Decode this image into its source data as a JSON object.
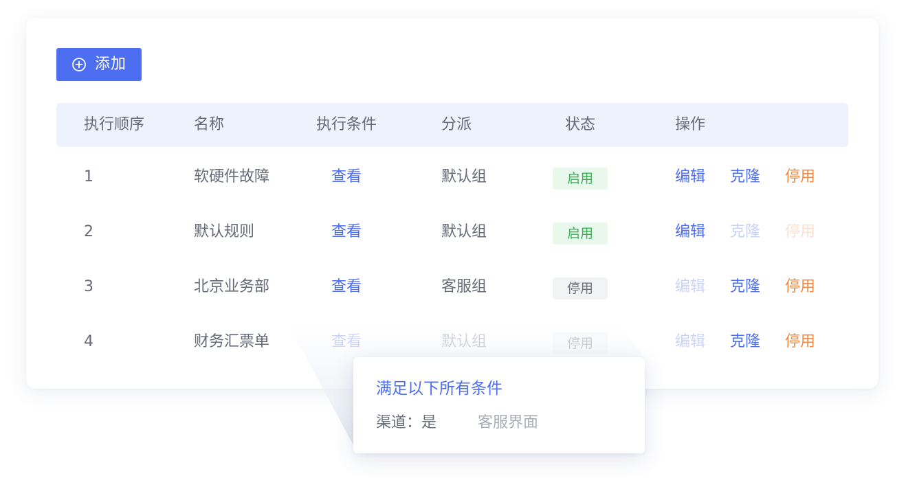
{
  "toolbar": {
    "add_label": "添加",
    "add_icon": "plus-circle-icon"
  },
  "table": {
    "headers": [
      "执行顺序",
      "名称",
      "执行条件",
      "分派",
      "状态",
      "操作"
    ],
    "rows": [
      {
        "order": "1",
        "name": "软硬件故障",
        "condition": "查看",
        "assign": "默认组",
        "status": "启用",
        "status_state": "enabled",
        "actions": {
          "edit": "编辑",
          "clone": "克隆",
          "disable": "停用"
        },
        "action_states": {
          "edit": "active",
          "clone": "active",
          "disable": "active"
        }
      },
      {
        "order": "2",
        "name": "默认规则",
        "condition": "查看",
        "assign": "默认组",
        "status": "启用",
        "status_state": "enabled",
        "actions": {
          "edit": "编辑",
          "clone": "克隆",
          "disable": "停用"
        },
        "action_states": {
          "edit": "active",
          "clone": "disabled",
          "disable": "disabled"
        }
      },
      {
        "order": "3",
        "name": "北京业务部",
        "condition": "查看",
        "assign": "客服组",
        "status": "停用",
        "status_state": "disabled",
        "actions": {
          "edit": "编辑",
          "clone": "克隆",
          "disable": "停用"
        },
        "action_states": {
          "edit": "disabled",
          "clone": "active",
          "disable": "active"
        }
      },
      {
        "order": "4",
        "name": "财务汇票单",
        "condition": "查看",
        "assign": "默认组",
        "status": "停用",
        "status_state": "disabled",
        "actions": {
          "edit": "编辑",
          "clone": "克隆",
          "disable": "停用"
        },
        "action_states": {
          "edit": "disabled",
          "clone": "active",
          "disable": "active"
        }
      }
    ]
  },
  "popover": {
    "title": "满足以下所有条件",
    "condition_key": "渠道：是",
    "condition_value": "客服界面"
  },
  "colors": {
    "primary": "#4e6ef2",
    "header_bg": "#edf2fd",
    "enabled_bg": "#e8f8ec",
    "enabled_text": "#34b252",
    "disabled_bg": "#f2f3f5",
    "danger_orange": "#f28b48"
  }
}
